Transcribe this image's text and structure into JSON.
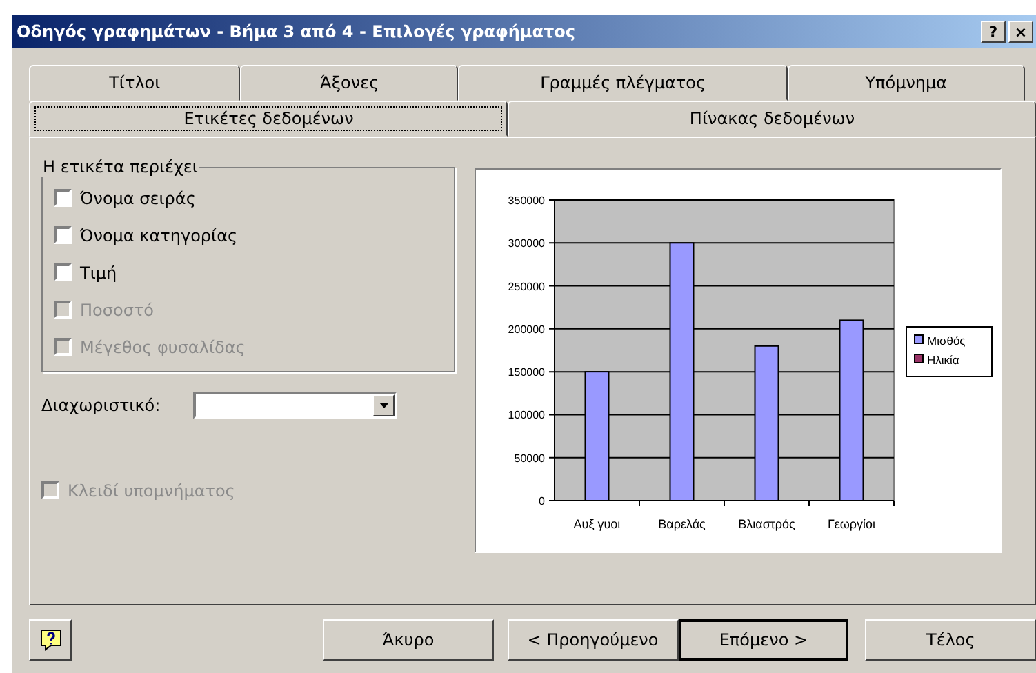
{
  "window": {
    "title": "Οδηγός γραφημάτων - Βήμα 3 από 4 - Επιλογές γραφήματος",
    "controls": [
      "?",
      "×"
    ]
  },
  "tab_rows": [
    [
      {
        "label": "Τίτλοι",
        "selected": false
      },
      {
        "label": "Άξονες",
        "selected": false
      },
      {
        "label": "Γραμμές πλέγματος",
        "selected": false
      },
      {
        "label": "Υπόμνημα",
        "selected": false
      }
    ],
    [
      {
        "label": "Ετικέτες δεδομένων",
        "selected": true
      },
      {
        "label": "Πίνακας δεδομένων",
        "selected": false
      }
    ]
  ],
  "label_group": {
    "title": "Η ετικέτα περιέχει",
    "options": [
      {
        "label": "Όνομα σειράς",
        "checked": false,
        "disabled": false
      },
      {
        "label": "Όνομα κατηγορίας",
        "checked": false,
        "disabled": false
      },
      {
        "label": "Τιμή",
        "checked": false,
        "disabled": false
      },
      {
        "label": "Ποσοστό",
        "checked": false,
        "disabled": true
      },
      {
        "label": "Μέγεθος φυσαλίδας",
        "checked": false,
        "disabled": true
      }
    ]
  },
  "separator": {
    "label": "Διαχωριστικό:"
  },
  "legend_key": {
    "label": "Κλειδί υπομνήματος",
    "checked": false,
    "disabled": true
  },
  "preview": {
    "chart_data": {
      "type": "bar",
      "categories": [
        "Αυξ γυοι",
        "Βαρελάς",
        "Βλιαστρός",
        "Γεωργίοι"
      ],
      "series": [
        {
          "name": "Μισθός",
          "color": "#9999ff",
          "values": [
            150000,
            300000,
            180000,
            210000
          ]
        },
        {
          "name": "Ηλικία",
          "color": "#993366",
          "values": [
            null,
            null,
            null,
            null
          ]
        }
      ],
      "grid": true,
      "ylim": [
        0,
        350000
      ],
      "yticks": [
        {
          "value": 0,
          "label": "0"
        },
        {
          "value": 50000,
          "label": "50000"
        },
        {
          "value": 100000,
          "label": "100000"
        },
        {
          "value": 150000,
          "label": "150000"
        },
        {
          "value": 200000,
          "label": "200000"
        },
        {
          "value": 250000,
          "label": "250000"
        },
        {
          "value": 300000,
          "label": "300000"
        },
        {
          "value": 350000,
          "label": "350000"
        }
      ]
    }
  },
  "buttons": [
    {
      "label": "Άκυρο",
      "default": false
    },
    {
      "label": "< Προηγούμενο",
      "default": false
    },
    {
      "label": "Επόμενο >",
      "default": true
    },
    {
      "label": "Τέλος",
      "default": false
    }
  ]
}
